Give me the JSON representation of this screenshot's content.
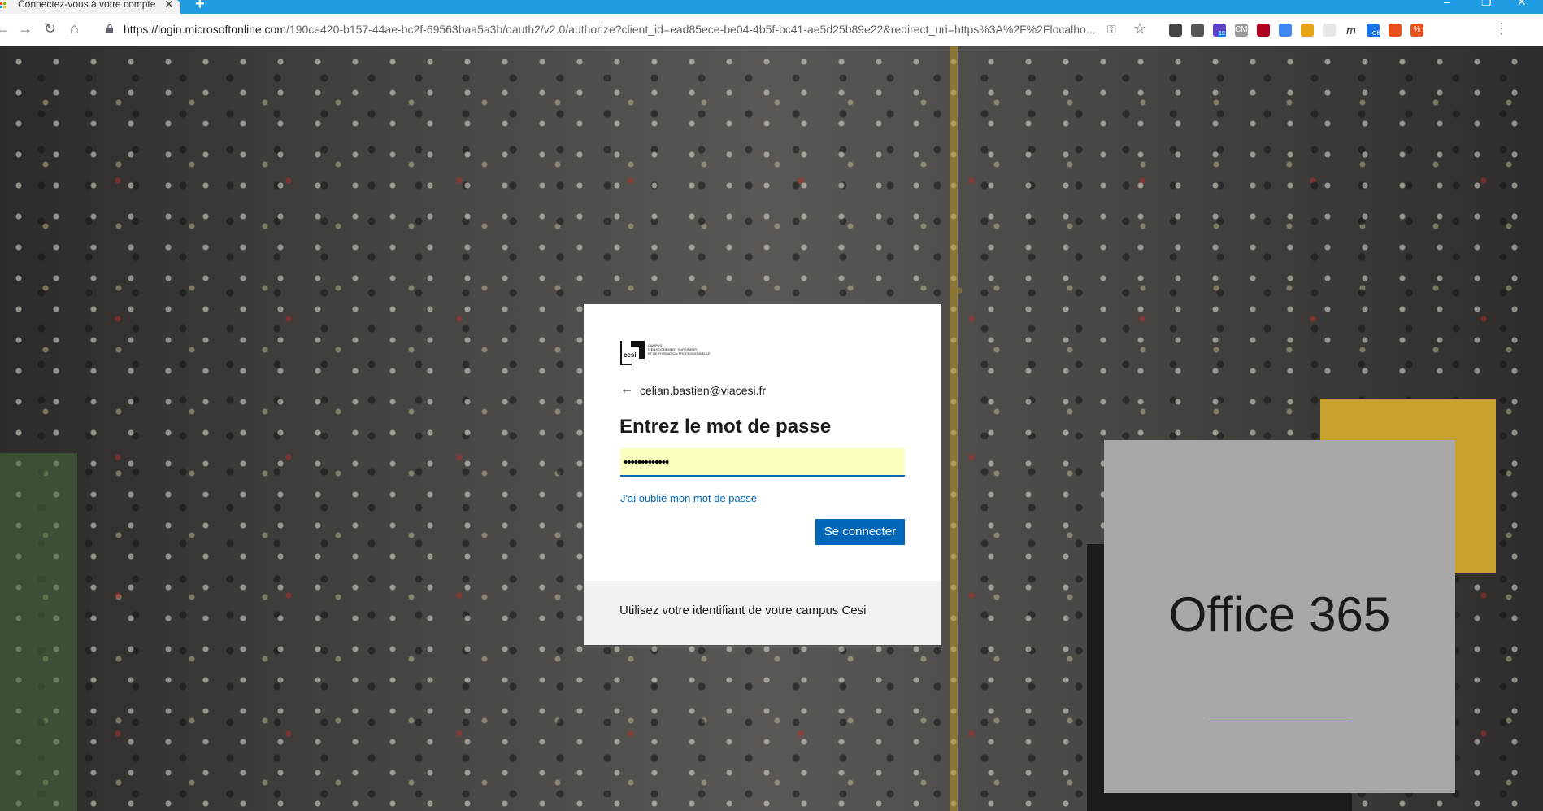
{
  "browser": {
    "tab_title": "Connectez-vous à votre compte",
    "tab_close": "✕",
    "new_tab": "+",
    "url_host": "https://login.microsoftonline.com",
    "url_path": "/190ce420-b157-44ae-bc2f-69563baa5a3b/oauth2/v2.0/authorize?client_id=ead85ece-be04-4b5f-bc41-ae5d25b89e22&redirect_uri=https%3A%2F%2Flocalho...",
    "extensions": [
      {
        "icon": "pen-extension-icon",
        "color": "#444444"
      },
      {
        "icon": "clipboard-extension-icon",
        "color": "#555555"
      },
      {
        "icon": "badge-extension-icon",
        "color": "#5b3fc4",
        "badge": "19"
      },
      {
        "icon": "cmx-extension-icon",
        "color": "#9a9a9a",
        "text": "CMX"
      },
      {
        "icon": "ublock-extension-icon",
        "color": "#b00020"
      },
      {
        "icon": "translate-extension-icon",
        "color": "#4285f4"
      },
      {
        "icon": "circle-extension-icon",
        "color": "#e8a317"
      },
      {
        "icon": "blank-extension-icon",
        "color": "#e6e6e6"
      },
      {
        "icon": "m-extension-icon",
        "color": "#ffffff",
        "text": "m"
      },
      {
        "icon": "off-extension-icon",
        "color": "#1a73e8",
        "badge": "Off"
      },
      {
        "icon": "orange-extension-icon",
        "color": "#e8501c"
      },
      {
        "icon": "percent-extension-icon",
        "color": "#e8501c",
        "text": "%"
      }
    ]
  },
  "login": {
    "identity": "celian.bastien@viacesi.fr",
    "heading": "Entrez le mot de passe",
    "password_value": "•••••••••••••",
    "forgot_link": "J'ai oublié mon mot de passe",
    "signin_button": "Se connecter",
    "footer_text": "Utilisez votre identifiant de votre campus Cesi",
    "logo_text": "cesi",
    "logo_tagline_1": "CAMPUS",
    "logo_tagline_2": "D'ENSEIGNEMENT SUPÉRIEUR",
    "logo_tagline_3": "ET DE FORMATION PROFESSIONNELLE"
  },
  "promo": {
    "title": "Office 365"
  },
  "colors": {
    "accent": "#0067b8",
    "gold": "#c9a12e",
    "autofill": "#faffbd"
  }
}
